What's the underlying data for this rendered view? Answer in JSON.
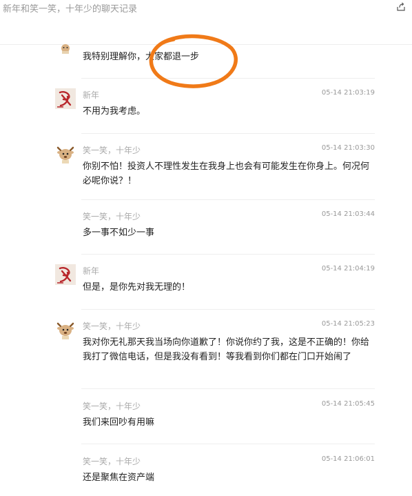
{
  "header": {
    "title": "新年和笑一笑，十年少的聊天记录"
  },
  "first_message": {
    "text": "我特别理解你，大家都退一步"
  },
  "messages": [
    {
      "name": "新年",
      "time": "05-14 21:03:19",
      "text": "不用为我考虑。",
      "avatar": "red-calligraphy-avatar"
    },
    {
      "name": "笑一笑，十年少",
      "time": "05-14 21:03:30",
      "text": "你别不怕！投资人不理性发生在我身上也会有可能发生在你身上。何况何必呢你说？！",
      "avatar": "deer-cartoon-avatar"
    },
    {
      "name": "笑一笑，十年少",
      "time": "05-14 21:03:44",
      "text": "多一事不如少一事"
    },
    {
      "name": "新年",
      "time": "05-14 21:04:19",
      "text": "但是，是你先对我无理的！",
      "avatar": "red-calligraphy-avatar"
    },
    {
      "name": "笑一笑，十年少",
      "time": "05-14 21:05:23",
      "text": "我对你无礼那天我当场向你道歉了！你说你约了我，这是不正确的！你给我打了微信电话，但是我没有看到！等我看到你们都在门口开始闹了",
      "avatar": "deer-cartoon-avatar"
    },
    {
      "name": "笑一笑，十年少",
      "time": "05-14 21:05:45",
      "text": "我们来回吵有用嘛"
    },
    {
      "name": "笑一笑，十年少",
      "time": "05-14 21:06:01",
      "text": "还是聚焦在资产端"
    }
  ],
  "colors": {
    "annotation": "#f07a18"
  }
}
